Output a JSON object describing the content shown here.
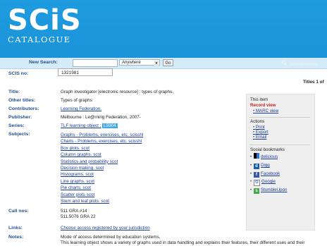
{
  "header": {
    "logo_main": "SCiS",
    "logo_sub": "CATALOGUE"
  },
  "search_bar": {
    "label": "New Search:",
    "input_value": "",
    "scope": "Anywhere",
    "go_label": "Go",
    "history_label": "Search history"
  },
  "record": {
    "scis_no_label": "SCIS no:",
    "scis_no": "1321981",
    "titles_of": "Titles 1 of",
    "title_label": "Title:",
    "title": "Graph investigator [electronic resource] : types of graphs.",
    "other_titles_label": "Other titles:",
    "other_titles": "Types of graphs",
    "contributors_label": "Contributors:",
    "contributors": "Learning Federation.",
    "publisher_label": "Publisher:",
    "publisher": "Melbourne : Le@rning Federation, 2007-",
    "series_label": "Series:",
    "series_text": "TLF learning object ;",
    "series_num": "L5904",
    "subjects_label": "Subjects:",
    "subjects": [
      "Graphs - Problems, exercises, etc. scisshl",
      "Charts - Problems, exercises, etc. scisshl",
      "Box plots. scot",
      "Column graphs. scot",
      "Statistics and probability scot",
      "Decision making. scot",
      "Histograms. scot",
      "Line graphs. scot",
      "Pie charts. scot",
      "Scatter plots scot",
      "Stem and leaf plots. scot"
    ],
    "call_nos_label": "Call nos:",
    "call_nos": [
      "511 GRA #14",
      "511.5076 GRA 22"
    ],
    "links_label": "Links:",
    "link": "Choose access registered by your jurisdiction",
    "notes_label": "Notes:",
    "notes": [
      "Mode of access determined by education systems.",
      "This learning object shows a variety of graphs used in data handling and explains their features, their different uses and their"
    ]
  },
  "side_panel": {
    "this_item": "This item",
    "record_view": "Record view",
    "marc_view": "MARC view",
    "actions_label": "Actions",
    "actions": [
      "Print",
      "Export",
      "Email"
    ],
    "social_label": "Social bookmarks",
    "social": [
      {
        "label": "delicious",
        "icon": "delicious-icon",
        "color": "#3274d1"
      },
      {
        "label": "Digg",
        "icon": "digg-icon",
        "color": "#1b5f9e"
      },
      {
        "label": "Facebook",
        "icon": "facebook-icon",
        "color": "#3b5998"
      },
      {
        "label": "Google",
        "icon": "google-icon",
        "color": "#ffffff"
      },
      {
        "label": "StumbleUpon",
        "icon": "stumbleupon-icon",
        "color": "#4ba54b"
      }
    ]
  }
}
